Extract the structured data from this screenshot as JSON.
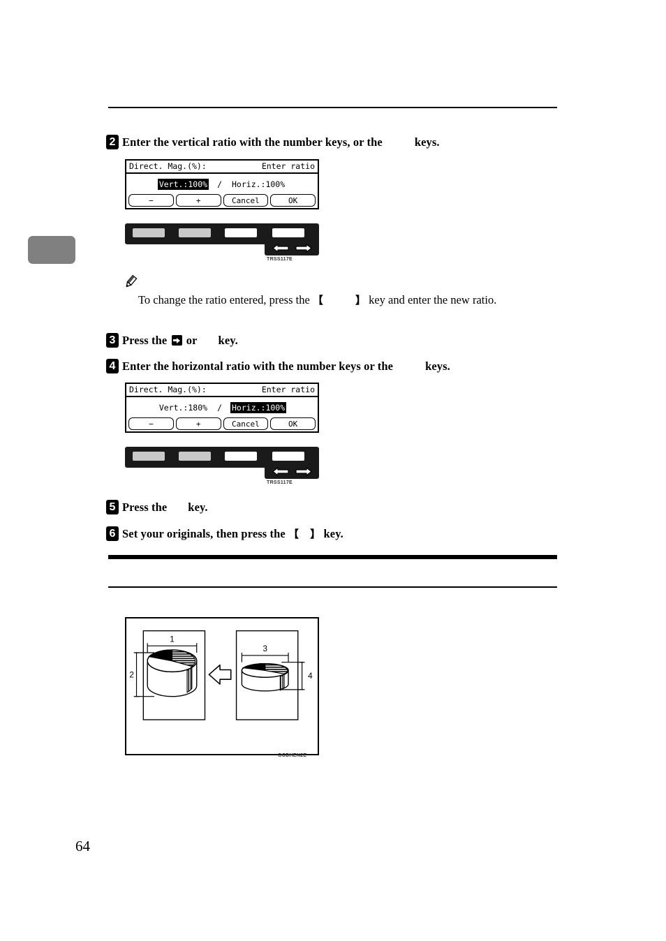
{
  "page": {
    "number": "64"
  },
  "steps": [
    {
      "num": "2",
      "text_before": "Enter the vertical ratio with the number keys, or the",
      "text_after": "keys."
    },
    {
      "num": "3",
      "text_before": "Press the",
      "text_mid": "or",
      "text_after": "key.",
      "icon": "arrow-right-box-icon"
    },
    {
      "num": "4",
      "text_before": "Enter the horizontal ratio with the number keys or the",
      "text_after": "keys."
    },
    {
      "num": "5",
      "text_before": "Press the",
      "text_after": "key."
    },
    {
      "num": "6",
      "text_before": "Set your originals, then press the",
      "bracket_open": "【",
      "bracket_close": "】",
      "text_after": "key."
    }
  ],
  "note": {
    "icon": "pencil-icon",
    "text_before": "To change the ratio entered, press the",
    "bracket_open": "【",
    "bracket_close": "】",
    "text_after": "key and enter the new ratio."
  },
  "lcd_panels": [
    {
      "id": "lcd-step2",
      "title_left": "Direct. Mag.(%):",
      "title_right": "Enter ratio",
      "vert_label": "Vert.:100%",
      "separator": "/",
      "horiz_label": "Horiz.:100%",
      "selected_field": "vert",
      "buttons": [
        "−",
        "+",
        "Cancel",
        "OK"
      ]
    },
    {
      "id": "lcd-step4",
      "title_left": "Direct. Mag.(%):",
      "title_right": "Enter ratio",
      "vert_label": "Vert.:180%",
      "separator": "/",
      "horiz_label": "Horiz.:100%",
      "selected_field": "horiz",
      "buttons": [
        "−",
        "+",
        "Cancel",
        "OK"
      ]
    }
  ],
  "keypads": [
    {
      "id": "keypad-step2",
      "caption": "TRSS117E",
      "arrow_left_icon": "arrow-left-icon",
      "arrow_right_icon": "arrow-right-icon"
    },
    {
      "id": "keypad-step4",
      "caption": "TRSS117E",
      "arrow_left_icon": "arrow-left-icon",
      "arrow_right_icon": "arrow-right-icon"
    }
  ],
  "illustration": {
    "caption": "GCDHEN2E",
    "labels": {
      "original_width": "1",
      "original_height": "2",
      "copy_width": "3",
      "copy_height": "4"
    },
    "arrow_icon": "block-arrow-right-icon",
    "left_chart": {
      "name": "original-pie-chart"
    },
    "right_chart": {
      "name": "reduced-pie-chart"
    }
  },
  "colors": {
    "ink": "#000000",
    "margin_tab": "#808080",
    "keypad_body": "#1a1a1a",
    "key_gray": "#c9c9c9"
  }
}
